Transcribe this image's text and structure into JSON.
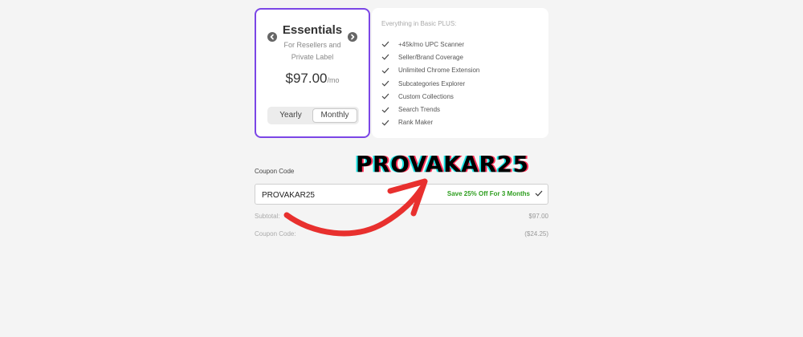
{
  "plan": {
    "title": "Essentials",
    "subtitle": "For Resellers and Private Label",
    "price": "$97.00",
    "per": "/mo",
    "toggle": {
      "yearly": "Yearly",
      "monthly": "Monthly",
      "selected": "Monthly"
    }
  },
  "features": {
    "heading": "Everything in Basic PLUS:",
    "items": [
      "+45k/mo UPC Scanner",
      "Seller/Brand Coverage",
      "Unlimited Chrome Extension",
      "Subcategories Explorer",
      "Custom Collections",
      "Search Trends",
      "Rank Maker"
    ]
  },
  "coupon": {
    "label": "Coupon Code",
    "value": "PROVAKAR25",
    "message": "Save 25% Off For 3 Months"
  },
  "summary": {
    "subtotal_label": "Subtotal:",
    "subtotal_value": "$97.00",
    "coupon_label": "Coupon Code:",
    "coupon_value": "($24.25)"
  },
  "promo_overlay": {
    "text": "PROVAKAR25",
    "arrow_color": "#e8302e"
  },
  "colors": {
    "accent": "#7b46e6",
    "success": "#2e9e1f",
    "background": "#f4f4f4"
  }
}
